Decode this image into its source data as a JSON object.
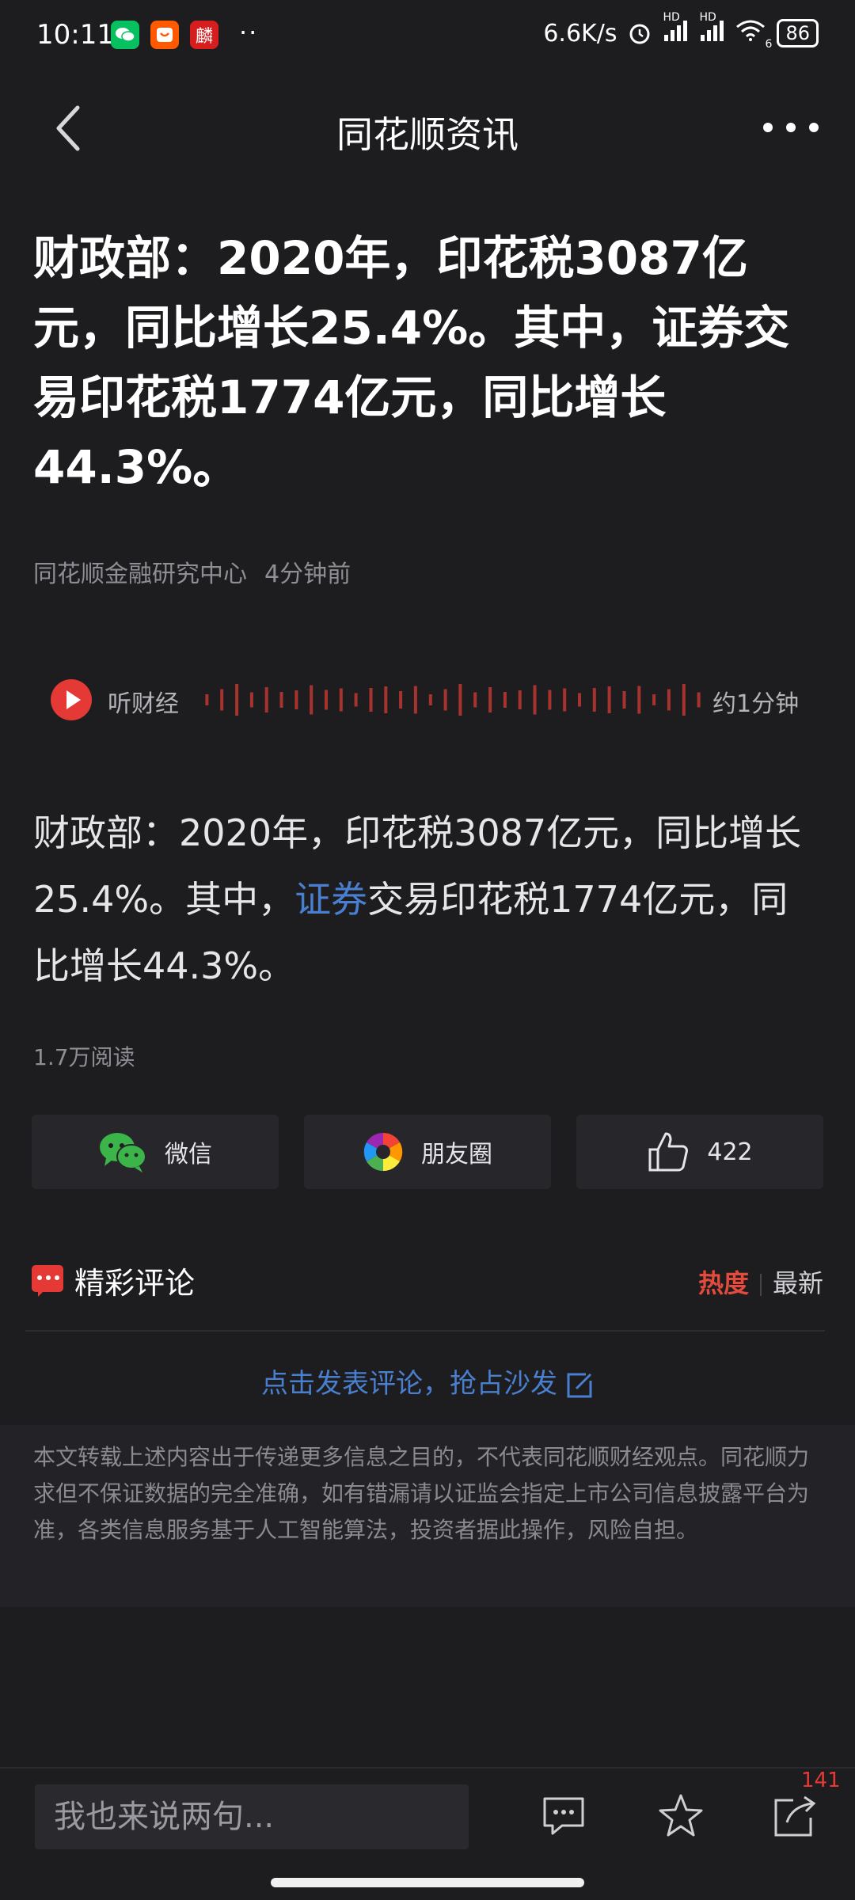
{
  "status_bar": {
    "time": "10:11",
    "apps": [
      {
        "name": "wechat-app-icon",
        "glyph": "✆",
        "color": "#07c160"
      },
      {
        "name": "shop-app-icon",
        "glyph": "◡",
        "color": "#ff5a00"
      },
      {
        "name": "red-app-icon",
        "glyph": "麟",
        "color": "#d71e1e"
      }
    ],
    "dots": "··",
    "net_speed": "6.6K/s",
    "hd1": "HD",
    "hd2": "HD",
    "wifi_badge": "6",
    "battery": "86"
  },
  "header": {
    "title": "同花顺资讯"
  },
  "article": {
    "title": "财政部：2020年，印花税3087亿元，同比增长25.4%。其中，证券交易印花税1774亿元，同比增长44.3%。",
    "source": "同花顺金融研究中心",
    "time": "4分钟前",
    "audio_label": "听财经",
    "audio_duration": "约1分钟",
    "body_prefix": "财政部：2020年，印花税3087亿元，同比增长25.4%。其中，",
    "body_link": "证券",
    "body_suffix": "交易印花税1774亿元，同比增长44.3%。",
    "reads": "1.7万阅读"
  },
  "share": {
    "wechat_label": "微信",
    "moments_label": "朋友圈",
    "like_count": "422"
  },
  "comments": {
    "title": "精彩评论",
    "sort_hot": "热度",
    "sort_new": "最新",
    "post_prompt": "点击发表评论，抢占沙发"
  },
  "disclaimer": "本文转载上述内容出于传递更多信息之目的，不代表同花顺财经观点。同花顺力求但不保证数据的完全准确，如有错漏请以证监会指定上市公司信息披露平台为准，各类信息服务基于人工智能算法，投资者据此操作，风险自担。",
  "bottom_bar": {
    "input_placeholder": "我也来说两句...",
    "share_count": "141"
  },
  "colors": {
    "accent_red": "#e53935",
    "link_blue": "#4a7fd0",
    "background": "#1d1d20"
  }
}
